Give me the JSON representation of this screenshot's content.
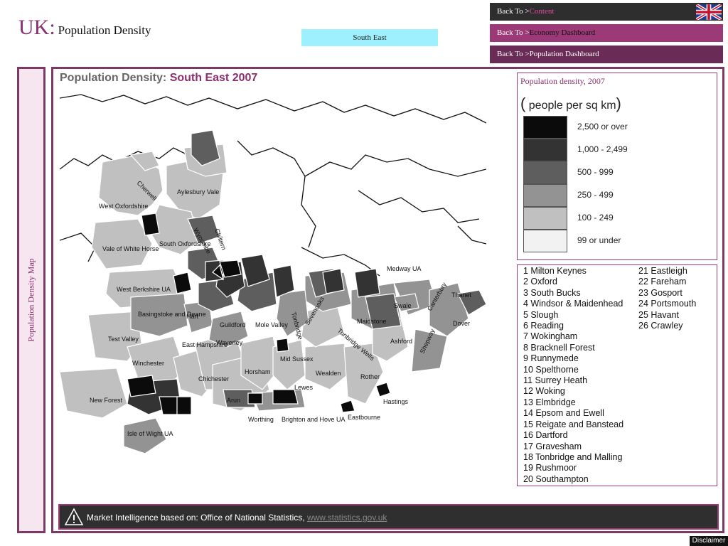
{
  "header": {
    "title_main": "UK:",
    "title_sub": "Population Density",
    "region": "South East"
  },
  "nav": [
    {
      "prefix": "Back  To  >",
      "target": "Content"
    },
    {
      "prefix": "Back  To  >",
      "target": "Economy Dashboard"
    },
    {
      "prefix": "Back  To  >",
      "target": "Population Dashboard"
    }
  ],
  "sidebar": {
    "label": "Population Density Map"
  },
  "map": {
    "title_prefix": "Population Density:",
    "title_accent": "South East 2007",
    "labels": [
      "Cherwell",
      "Aylesbury Vale",
      "West Oxfordshire",
      "South Oxfordshire",
      "Vale of White Horse",
      "Wycombe",
      "Chiltern",
      "West Berkshire UA",
      "Basingstoke and Deane",
      "Hart",
      "Guildford",
      "Mole Valley",
      "Waverley",
      "East Hampshire",
      "Test Valley",
      "Winchester",
      "New Forest",
      "Isle of Wight UA",
      "Chichester",
      "Horsham",
      "Arun",
      "Worthing",
      "Brighton and Hove UA",
      "Lewes",
      "Mid Sussex",
      "Wealden",
      "Rother",
      "Hastings",
      "Eastbourne",
      "Sevenoaks",
      "Tonbridge",
      "Tunbridge Wells",
      "Maidstone",
      "Swale",
      "Ashford",
      "Canterbury",
      "Dover",
      "Shepway",
      "Thanet",
      "Medway UA"
    ]
  },
  "legend": {
    "title": "Population density, 2007",
    "unit": "people per sq km",
    "classes": [
      {
        "label": "2,500 or over",
        "color": "#0b0b0b"
      },
      {
        "label": "1,000 - 2,499",
        "color": "#333333"
      },
      {
        "label": "500 - 999",
        "color": "#5e5e5e"
      },
      {
        "label": "250 - 499",
        "color": "#939393"
      },
      {
        "label": "100 - 249",
        "color": "#c0c0c0"
      },
      {
        "label": "99 or under",
        "color": "#f2f2f2"
      }
    ]
  },
  "key": {
    "col1": [
      "1 Milton Keynes",
      "2 Oxford",
      "3 South Bucks",
      "4 Windsor & Maidenhead",
      "5 Slough",
      "6 Reading",
      "7 Wokingham",
      "8 Bracknell Forest",
      "9 Runnymede",
      "10 Spelthorne",
      "11 Surrey Heath",
      "12 Woking",
      "13 Elmbridge",
      "14 Epsom and Ewell",
      "15 Reigate and Banstead",
      "16 Dartford",
      "17 Gravesham",
      "18 Tonbridge and Malling",
      "19 Rushmoor",
      "20 Southampton"
    ],
    "col2": [
      "21 Eastleigh",
      "22 Fareham",
      "23 Gosport",
      "24 Portsmouth",
      "25 Havant",
      "26 Crawley"
    ]
  },
  "footer": {
    "text": "Market Intelligence based on: Office of National Statistics,",
    "link": "www.statistics.gov.uk"
  },
  "disclaimer": "Disclaimer"
}
